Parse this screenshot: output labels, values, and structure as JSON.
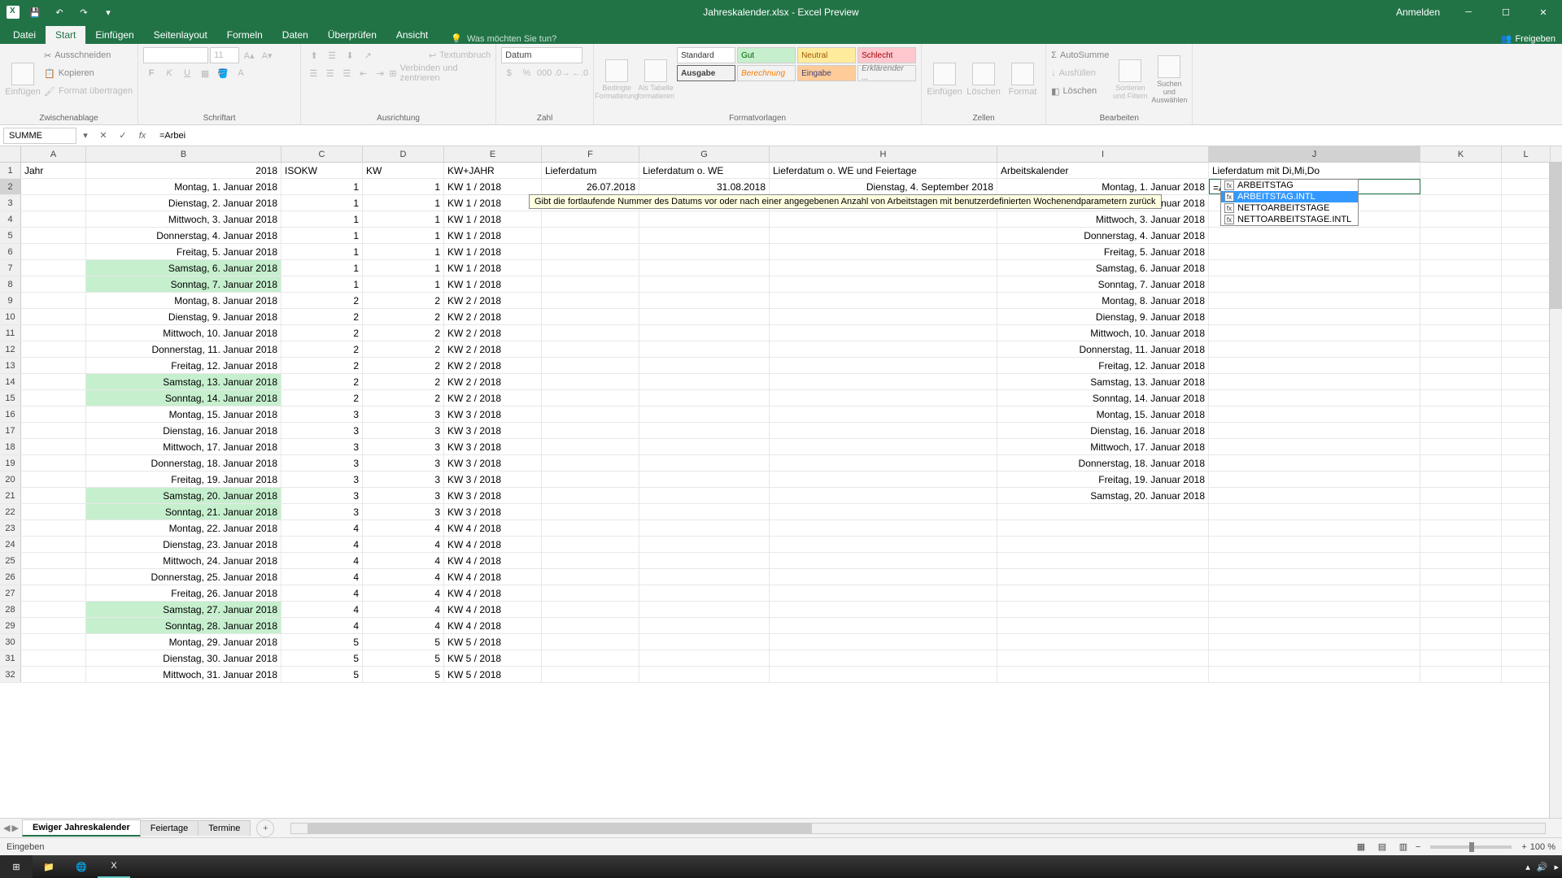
{
  "app": {
    "title": "Jahreskalender.xlsx - Excel Preview",
    "signin": "Anmelden"
  },
  "tabs": {
    "datei": "Datei",
    "start": "Start",
    "einfuegen": "Einfügen",
    "seitenlayout": "Seitenlayout",
    "formeln": "Formeln",
    "daten": "Daten",
    "ueberpruefen": "Überprüfen",
    "ansicht": "Ansicht",
    "tellme": "Was möchten Sie tun?",
    "freigeben": "Freigeben"
  },
  "ribbon": {
    "clipboard": {
      "paste": "Einfügen",
      "cut": "Ausschneiden",
      "copy": "Kopieren",
      "format": "Format übertragen",
      "label": "Zwischenablage"
    },
    "font": {
      "size": "11",
      "label": "Schriftart"
    },
    "align": {
      "wrap": "Textumbruch",
      "merge": "Verbinden und zentrieren",
      "label": "Ausrichtung"
    },
    "number": {
      "format": "Datum",
      "label": "Zahl"
    },
    "styles": {
      "cond": "Bedingte Formatierung",
      "table": "Als Tabelle formatieren",
      "std": "Standard",
      "gut": "Gut",
      "neutral": "Neutral",
      "schlecht": "Schlecht",
      "ausgabe": "Ausgabe",
      "berechnung": "Berechnung",
      "eingabe": "Eingabe",
      "erklaerend": "Erklärender ...",
      "label": "Formatvorlagen"
    },
    "cells": {
      "insert": "Einfügen",
      "delete": "Löschen",
      "format": "Format",
      "label": "Zellen"
    },
    "editing": {
      "sum": "AutoSumme",
      "fill": "Ausfüllen",
      "clear": "Löschen",
      "sort": "Sortieren und Filtern",
      "find": "Suchen und Auswählen",
      "label": "Bearbeiten"
    }
  },
  "formula_bar": {
    "name": "SUMME",
    "formula": "=Arbei"
  },
  "cols": {
    "A": "A",
    "B": "B",
    "C": "C",
    "D": "D",
    "E": "E",
    "F": "F",
    "G": "G",
    "H": "H",
    "I": "I",
    "J": "J",
    "K": "K",
    "L": "L"
  },
  "headers": {
    "A": "Jahr",
    "B": "2018",
    "C": "ISOKW",
    "D": "KW",
    "E": "KW+JAHR",
    "F": "Lieferdatum",
    "G": "Lieferdatum o. WE",
    "H": "Lieferdatum o. WE und Feiertage",
    "I": "Arbeitskalender",
    "J": "Lieferdatum mit Di,Mi,Do"
  },
  "editing_cell": {
    "value": "=Arbei"
  },
  "tooltip": "Gibt die fortlaufende Nummer des Datums vor oder nach einer angegebenen Anzahl von Arbeitstagen mit benutzerdefinierten Wochenendparametern zurück",
  "funclist": [
    "ARBEITSTAG",
    "ARBEITSTAG.INTL",
    "NETTOARBEITSTAGE",
    "NETTOARBEITSTAGE.INTL"
  ],
  "rows": [
    {
      "n": 2,
      "B": "Montag, 1. Januar 2018",
      "C": "1",
      "D": "1",
      "E": "KW 1 / 2018",
      "F": "26.07.2018",
      "G": "31.08.2018",
      "H": "Dienstag, 4. September 2018",
      "I": "Montag, 1. Januar 2018",
      "we": false,
      "edit": true
    },
    {
      "n": 3,
      "B": "Dienstag, 2. Januar 2018",
      "C": "1",
      "D": "1",
      "E": "KW 1 / 2018",
      "I": "Dienstag, 2. Januar 2018",
      "we": false
    },
    {
      "n": 4,
      "B": "Mittwoch, 3. Januar 2018",
      "C": "1",
      "D": "1",
      "E": "KW 1 / 2018",
      "I": "Mittwoch, 3. Januar 2018",
      "we": false,
      "tip": true
    },
    {
      "n": 5,
      "B": "Donnerstag, 4. Januar 2018",
      "C": "1",
      "D": "1",
      "E": "KW 1 / 2018",
      "I": "Donnerstag, 4. Januar 2018",
      "we": false
    },
    {
      "n": 6,
      "B": "Freitag, 5. Januar 2018",
      "C": "1",
      "D": "1",
      "E": "KW 1 / 2018",
      "I": "Freitag, 5. Januar 2018",
      "we": false
    },
    {
      "n": 7,
      "B": "Samstag, 6. Januar 2018",
      "C": "1",
      "D": "1",
      "E": "KW 1 / 2018",
      "I": "Samstag, 6. Januar 2018",
      "we": true
    },
    {
      "n": 8,
      "B": "Sonntag, 7. Januar 2018",
      "C": "1",
      "D": "1",
      "E": "KW 1 / 2018",
      "I": "Sonntag, 7. Januar 2018",
      "we": true
    },
    {
      "n": 9,
      "B": "Montag, 8. Januar 2018",
      "C": "2",
      "D": "2",
      "E": "KW 2 / 2018",
      "I": "Montag, 8. Januar 2018",
      "we": false
    },
    {
      "n": 10,
      "B": "Dienstag, 9. Januar 2018",
      "C": "2",
      "D": "2",
      "E": "KW 2 / 2018",
      "I": "Dienstag, 9. Januar 2018",
      "we": false
    },
    {
      "n": 11,
      "B": "Mittwoch, 10. Januar 2018",
      "C": "2",
      "D": "2",
      "E": "KW 2 / 2018",
      "I": "Mittwoch, 10. Januar 2018",
      "we": false
    },
    {
      "n": 12,
      "B": "Donnerstag, 11. Januar 2018",
      "C": "2",
      "D": "2",
      "E": "KW 2 / 2018",
      "I": "Donnerstag, 11. Januar 2018",
      "we": false
    },
    {
      "n": 13,
      "B": "Freitag, 12. Januar 2018",
      "C": "2",
      "D": "2",
      "E": "KW 2 / 2018",
      "I": "Freitag, 12. Januar 2018",
      "we": false
    },
    {
      "n": 14,
      "B": "Samstag, 13. Januar 2018",
      "C": "2",
      "D": "2",
      "E": "KW 2 / 2018",
      "I": "Samstag, 13. Januar 2018",
      "we": true
    },
    {
      "n": 15,
      "B": "Sonntag, 14. Januar 2018",
      "C": "2",
      "D": "2",
      "E": "KW 2 / 2018",
      "I": "Sonntag, 14. Januar 2018",
      "we": true
    },
    {
      "n": 16,
      "B": "Montag, 15. Januar 2018",
      "C": "3",
      "D": "3",
      "E": "KW 3 / 2018",
      "I": "Montag, 15. Januar 2018",
      "we": false
    },
    {
      "n": 17,
      "B": "Dienstag, 16. Januar 2018",
      "C": "3",
      "D": "3",
      "E": "KW 3 / 2018",
      "I": "Dienstag, 16. Januar 2018",
      "we": false
    },
    {
      "n": 18,
      "B": "Mittwoch, 17. Januar 2018",
      "C": "3",
      "D": "3",
      "E": "KW 3 / 2018",
      "I": "Mittwoch, 17. Januar 2018",
      "we": false
    },
    {
      "n": 19,
      "B": "Donnerstag, 18. Januar 2018",
      "C": "3",
      "D": "3",
      "E": "KW 3 / 2018",
      "I": "Donnerstag, 18. Januar 2018",
      "we": false
    },
    {
      "n": 20,
      "B": "Freitag, 19. Januar 2018",
      "C": "3",
      "D": "3",
      "E": "KW 3 / 2018",
      "I": "Freitag, 19. Januar 2018",
      "we": false
    },
    {
      "n": 21,
      "B": "Samstag, 20. Januar 2018",
      "C": "3",
      "D": "3",
      "E": "KW 3 / 2018",
      "I": "Samstag, 20. Januar 2018",
      "we": true
    },
    {
      "n": 22,
      "B": "Sonntag, 21. Januar 2018",
      "C": "3",
      "D": "3",
      "E": "KW 3 / 2018",
      "we": true
    },
    {
      "n": 23,
      "B": "Montag, 22. Januar 2018",
      "C": "4",
      "D": "4",
      "E": "KW 4 / 2018",
      "we": false
    },
    {
      "n": 24,
      "B": "Dienstag, 23. Januar 2018",
      "C": "4",
      "D": "4",
      "E": "KW 4 / 2018",
      "we": false
    },
    {
      "n": 25,
      "B": "Mittwoch, 24. Januar 2018",
      "C": "4",
      "D": "4",
      "E": "KW 4 / 2018",
      "we": false
    },
    {
      "n": 26,
      "B": "Donnerstag, 25. Januar 2018",
      "C": "4",
      "D": "4",
      "E": "KW 4 / 2018",
      "we": false
    },
    {
      "n": 27,
      "B": "Freitag, 26. Januar 2018",
      "C": "4",
      "D": "4",
      "E": "KW 4 / 2018",
      "we": false
    },
    {
      "n": 28,
      "B": "Samstag, 27. Januar 2018",
      "C": "4",
      "D": "4",
      "E": "KW 4 / 2018",
      "we": true
    },
    {
      "n": 29,
      "B": "Sonntag, 28. Januar 2018",
      "C": "4",
      "D": "4",
      "E": "KW 4 / 2018",
      "we": true
    },
    {
      "n": 30,
      "B": "Montag, 29. Januar 2018",
      "C": "5",
      "D": "5",
      "E": "KW 5 / 2018",
      "we": false
    },
    {
      "n": 31,
      "B": "Dienstag, 30. Januar 2018",
      "C": "5",
      "D": "5",
      "E": "KW 5 / 2018",
      "we": false
    },
    {
      "n": 32,
      "B": "Mittwoch, 31. Januar 2018",
      "C": "5",
      "D": "5",
      "E": "KW 5 / 2018",
      "we": false
    }
  ],
  "sheets": {
    "s1": "Ewiger Jahreskalender",
    "s2": "Feiertage",
    "s3": "Termine"
  },
  "status": {
    "mode": "Eingeben",
    "zoom": "100 %"
  }
}
